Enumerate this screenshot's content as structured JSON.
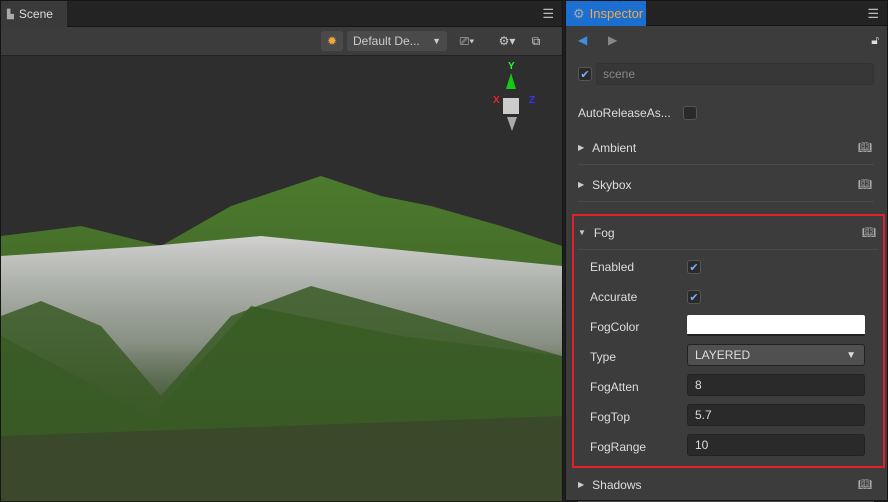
{
  "scene": {
    "tab_label": "Scene",
    "camera_label": "Default De...",
    "menu_icon": "hamburger-icon",
    "gizmo": {
      "x": "X",
      "y": "Y",
      "z": "Z"
    }
  },
  "inspector": {
    "tab_label": "Inspector",
    "node_name": "scene",
    "node_enabled": true,
    "auto_release_label": "AutoReleaseAs...",
    "auto_release": false,
    "sections": {
      "ambient": "Ambient",
      "skybox": "Skybox",
      "fog": "Fog",
      "shadows": "Shadows"
    },
    "fog": {
      "enabled_label": "Enabled",
      "enabled": true,
      "accurate_label": "Accurate",
      "accurate": true,
      "color_label": "FogColor",
      "color": "#ffffff",
      "type_label": "Type",
      "type": "LAYERED",
      "atten_label": "FogAtten",
      "atten": "8",
      "top_label": "FogTop",
      "top": "5.7",
      "range_label": "FogRange",
      "range": "10"
    },
    "highlight_color": "#e0202a"
  }
}
